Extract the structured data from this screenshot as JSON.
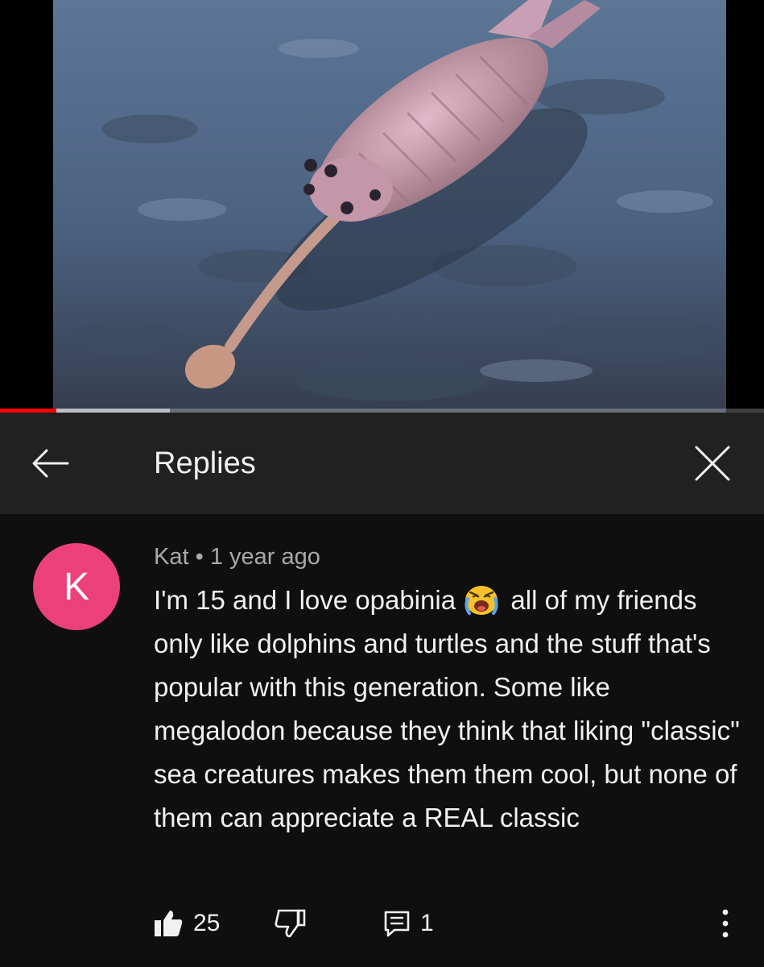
{
  "video": {
    "progress_played": 0.074,
    "progress_buffered": 0.222,
    "accent_color": "#ff0000"
  },
  "header": {
    "title": "Replies",
    "back_icon": "arrow-left-icon",
    "close_icon": "close-icon"
  },
  "comment": {
    "avatar_letter": "K",
    "avatar_color": "#ec407a",
    "author": "Kat",
    "separator": "•",
    "time": "1 year ago",
    "text_part1": "I'm 15 and I love opabinia",
    "emoji": "loudly-crying-face-emoji",
    "text_part2": "all of my friends only like dolphins and turtles and the stuff that's popular with this generation. Some like megalodon because they think that liking \"classic\" sea creatures makes them them cool, but none of them can appreciate a REAL classic",
    "like_count": "25",
    "reply_count": "1"
  }
}
